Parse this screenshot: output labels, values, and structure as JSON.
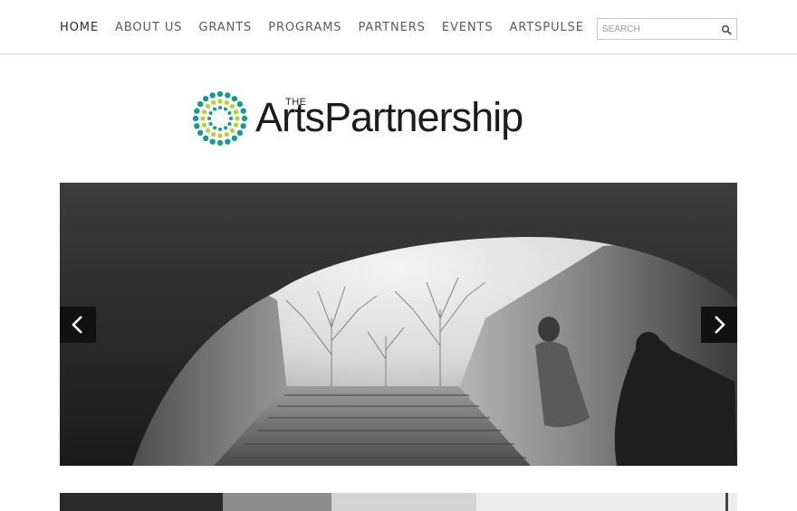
{
  "nav": {
    "items": [
      {
        "label": "HOME",
        "active": true
      },
      {
        "label": "ABOUT US"
      },
      {
        "label": "GRANTS"
      },
      {
        "label": "PROGRAMS"
      },
      {
        "label": "PARTNERS"
      },
      {
        "label": "EVENTS"
      },
      {
        "label": "ARTSPULSE"
      }
    ]
  },
  "search": {
    "placeholder": "SEARCH",
    "icon": "search-icon"
  },
  "logo": {
    "the": "THE",
    "name": "ArtsPartnership",
    "colors": {
      "teal": "#1a9a8a",
      "lime": "#b7cf3a"
    }
  },
  "slider": {
    "prev_icon": "chevron-left-icon",
    "next_icon": "chevron-right-icon",
    "image": "black-and-white photo of two people climbing stairs under a stone arch toward bare winter trees"
  },
  "colors": {
    "nav_text": "#5a5a5a",
    "arrow_bg": "#111111"
  }
}
